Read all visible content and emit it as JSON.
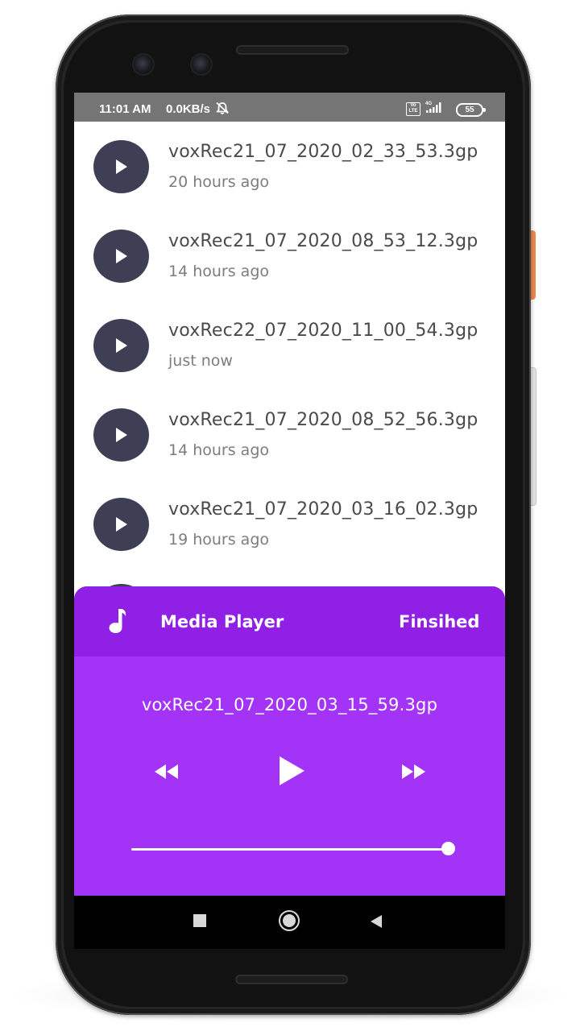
{
  "status_bar": {
    "time": "11:01 AM",
    "network_speed": "0.0KB/s",
    "alarm_icon": "alarm-off-icon",
    "volte_label": "Vo LTE",
    "signal_label": "4G",
    "battery": "55"
  },
  "recordings": [
    {
      "name": "voxRec21_07_2020_02_33_53.3gp",
      "time": "20 hours ago"
    },
    {
      "name": "voxRec21_07_2020_08_53_12.3gp",
      "time": "14 hours ago"
    },
    {
      "name": "voxRec22_07_2020_11_00_54.3gp",
      "time": "just now"
    },
    {
      "name": "voxRec21_07_2020_08_52_56.3gp",
      "time": "14 hours ago"
    },
    {
      "name": "voxRec21_07_2020_03_16_02.3gp",
      "time": "19 hours ago"
    }
  ],
  "player": {
    "title": "Media Player",
    "status": "Finsihed",
    "current_file": "voxRec21_07_2020_03_15_59.3gp",
    "progress": 1.0,
    "icons": {
      "header": "music-note-icon",
      "rewind": "rewind-icon",
      "play": "play-icon",
      "forward": "fast-forward-icon"
    }
  },
  "navigation": {
    "recents": "square-icon",
    "home": "home-circle-icon",
    "back": "back-triangle-icon"
  },
  "colors": {
    "player_body": "#a333f6",
    "player_header": "#9020e6",
    "play_button_bg": "#3e3f55",
    "status_bar": "#757575"
  }
}
